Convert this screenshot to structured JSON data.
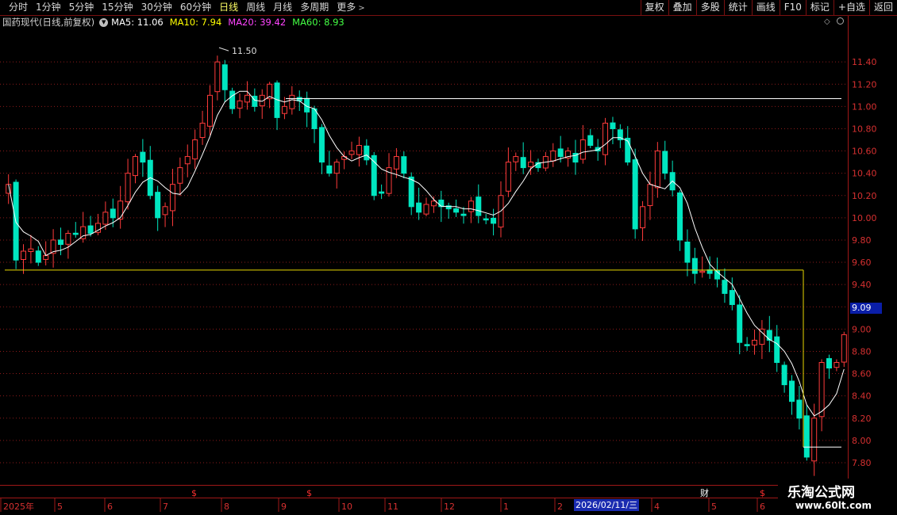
{
  "toolbar": {
    "periods": [
      {
        "label": "分时",
        "active": false
      },
      {
        "label": "1分钟",
        "active": false
      },
      {
        "label": "5分钟",
        "active": false
      },
      {
        "label": "15分钟",
        "active": false
      },
      {
        "label": "30分钟",
        "active": false
      },
      {
        "label": "60分钟",
        "active": false
      },
      {
        "label": "日线",
        "active": true
      },
      {
        "label": "周线",
        "active": false
      },
      {
        "label": "月线",
        "active": false
      },
      {
        "label": "多周期",
        "active": false
      },
      {
        "label": "更多",
        "active": false
      }
    ],
    "buttons": [
      "复权",
      "叠加",
      "多股",
      "统计",
      "画线",
      "F10",
      "标记",
      "+自选",
      "返回"
    ]
  },
  "info": {
    "stock_label": "国药现代(日线,前复权)",
    "ma5": "MA5: 11.06",
    "ma10": "MA10: 7.94",
    "ma20": "MA20: 39.42",
    "ma60": "MA60: 8.93"
  },
  "colors": {
    "up": "#ff3b3b",
    "down": "#00e6c0",
    "ma5": "#ffffff",
    "ma10": "#ffff00",
    "ma20": "#ff44ff",
    "ma60": "#44ff44",
    "grid": "#8b1a1a",
    "hline_white": "#ffffff",
    "hline_yellow": "#e8d800",
    "axis_text": "#d63030",
    "price_tag_bg": "#0a1ea8"
  },
  "chart_data": {
    "type": "candlestick",
    "y_axis": {
      "ticks": [
        7.8,
        8.0,
        8.2,
        8.4,
        8.6,
        8.8,
        9.0,
        9.2,
        9.4,
        9.6,
        9.8,
        10.0,
        10.2,
        10.4,
        10.6,
        10.8,
        11.0,
        11.2,
        11.4
      ],
      "ylim": [
        7.7,
        11.7
      ]
    },
    "x_axis": {
      "labels": [
        "2025年",
        "5",
        "6",
        "7",
        "8",
        "9",
        "10",
        "11",
        "12",
        "1",
        "2",
        "4",
        "5",
        "6"
      ],
      "cursor_label": "2026/02/11/三"
    },
    "price_tag": "9.09",
    "high_annotation": "11.50",
    "high_annotation_value": 11.5,
    "event_marks": [
      "$",
      "$",
      "财",
      "$"
    ],
    "horizontal_lines": [
      {
        "value": 11.07,
        "color": "white"
      },
      {
        "value": 9.53,
        "color": "yellow"
      },
      {
        "value": 7.94,
        "color": "white"
      }
    ],
    "series": [
      {
        "name": "close",
        "values": [
          10.3,
          9.62,
          9.7,
          9.72,
          9.6,
          9.66,
          9.8,
          9.76,
          9.86,
          9.85,
          9.92,
          9.86,
          9.95,
          10.05,
          10.0,
          10.15,
          10.4,
          10.55,
          10.5,
          10.2,
          10.0,
          10.1,
          10.3,
          10.45,
          10.55,
          10.7,
          10.85,
          11.1,
          11.4,
          11.15,
          10.98,
          11.05,
          11.1,
          11.0,
          11.1,
          11.2,
          10.9,
          11.0,
          11.1,
          11.05,
          10.95,
          10.8,
          10.5,
          10.4,
          10.5,
          10.55,
          10.6,
          10.65,
          10.52,
          10.2,
          10.22,
          10.45,
          10.55,
          10.4,
          10.1,
          10.05,
          10.12,
          10.15,
          10.1,
          10.08,
          10.05,
          10.02,
          10.15,
          10.02,
          9.98,
          9.95,
          10.2,
          10.5,
          10.55,
          10.45,
          10.5,
          10.45,
          10.55,
          10.6,
          10.55,
          10.6,
          10.5,
          10.7,
          10.65,
          10.6,
          10.85,
          10.8,
          10.7,
          10.5,
          9.9,
          10.1,
          10.3,
          10.6,
          10.4,
          10.25,
          9.8,
          9.6,
          9.5,
          9.52,
          9.5,
          9.45,
          9.32,
          9.22,
          8.88,
          8.85,
          8.9,
          9.0,
          8.9,
          8.7,
          8.5,
          8.35,
          8.2,
          7.85,
          8.2,
          8.7,
          8.65,
          8.7,
          8.95
        ]
      }
    ]
  }
}
